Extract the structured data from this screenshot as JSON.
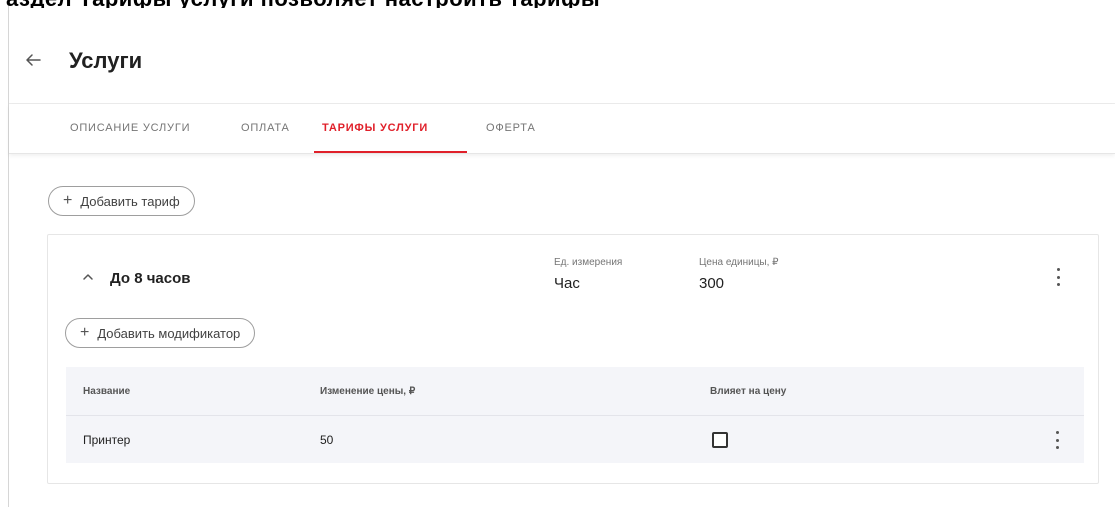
{
  "page": {
    "title": "Услуги",
    "top_clipped_text": "аздел Тарифы услуги позволяет настроить тарифы"
  },
  "tabs": [
    {
      "label": "ОПИСАНИЕ УСЛУГИ",
      "active": false
    },
    {
      "label": "ОПЛАТА",
      "active": false
    },
    {
      "label": "ТАРИФЫ УСЛУГИ",
      "active": true
    },
    {
      "label": "ОФЕРТА",
      "active": false
    }
  ],
  "actions": {
    "add_tariff_label": "Добавить тариф",
    "add_modifier_label": "Добавить модификатор"
  },
  "tariff": {
    "name": "До 8 часов",
    "unit_label": "Ед. измерения",
    "unit_value": "Час",
    "price_label": "Цена единицы, ₽",
    "price_value": "300"
  },
  "modifiers": {
    "columns": [
      "Название",
      "Изменение цены, ₽",
      "Влияет на цену"
    ],
    "rows": [
      {
        "name": "Принтер",
        "price_change": "50",
        "affects_price": false
      }
    ]
  },
  "colors": {
    "accent": "#e0202a",
    "table_bg": "#f4f5f9"
  },
  "icons": [
    "arrow-left-icon",
    "plus-icon",
    "chevron-up-icon",
    "kebab-menu-icon",
    "checkbox"
  ]
}
